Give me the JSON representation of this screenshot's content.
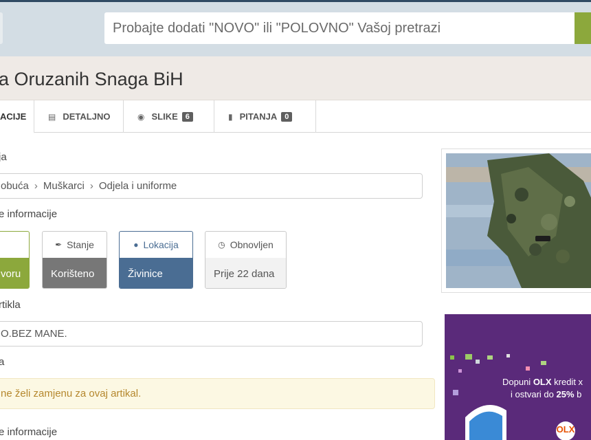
{
  "search": {
    "placeholder": "Probajte dodati \"NOVO\" ili \"POLOVNO\" Vašoj pretrazi"
  },
  "listing": {
    "title": "a Oruzanih Snaga BiH"
  },
  "tabs": [
    {
      "label": "ACIJE",
      "icon": "info-icon"
    },
    {
      "label": "DETALJNO",
      "icon": "document-icon"
    },
    {
      "label": "SLIKE",
      "count": "6",
      "icon": "camera-icon"
    },
    {
      "label": "PITANJA",
      "count": "0",
      "icon": "chat-icon"
    }
  ],
  "category": {
    "label": "ja",
    "path": [
      "obuća",
      "Muškarci",
      "Odjela i uniforme"
    ]
  },
  "info": {
    "label": "e informacije",
    "cards": [
      {
        "title": "",
        "value": "voru",
        "icon": "",
        "color": "#8ca83c"
      },
      {
        "title": "Stanje",
        "value": "Korišteno",
        "icon": "brush-icon",
        "color": "#777777"
      },
      {
        "title": "Lokacija",
        "value": "Živinice",
        "icon": "location-pin-icon",
        "color": "#4a6d93"
      },
      {
        "title": "Obnovljen",
        "value": "Prije 22 dana",
        "icon": "clock-icon",
        "color": "#f2f2f2"
      }
    ]
  },
  "description": {
    "label": "rtikla",
    "value": "O.BEZ MANE."
  },
  "exchange": {
    "label": "a",
    "notice": "ne želi zamjenu za ovaj artikal."
  },
  "more_info": {
    "label": "e informacije"
  },
  "ad": {
    "line1_pre": "Dopuni ",
    "line1_brand": "OLX",
    "line1_post": " kredit x",
    "line2_pre": "i ostvari do ",
    "line2_bold": "25%",
    "line2_post": " b",
    "logo_text": "OLX"
  },
  "colors": {
    "accent_green": "#8ca83c",
    "header_band": "#d3dde4",
    "title_band": "#efeae6",
    "ad_purple": "#5a2a7a"
  }
}
